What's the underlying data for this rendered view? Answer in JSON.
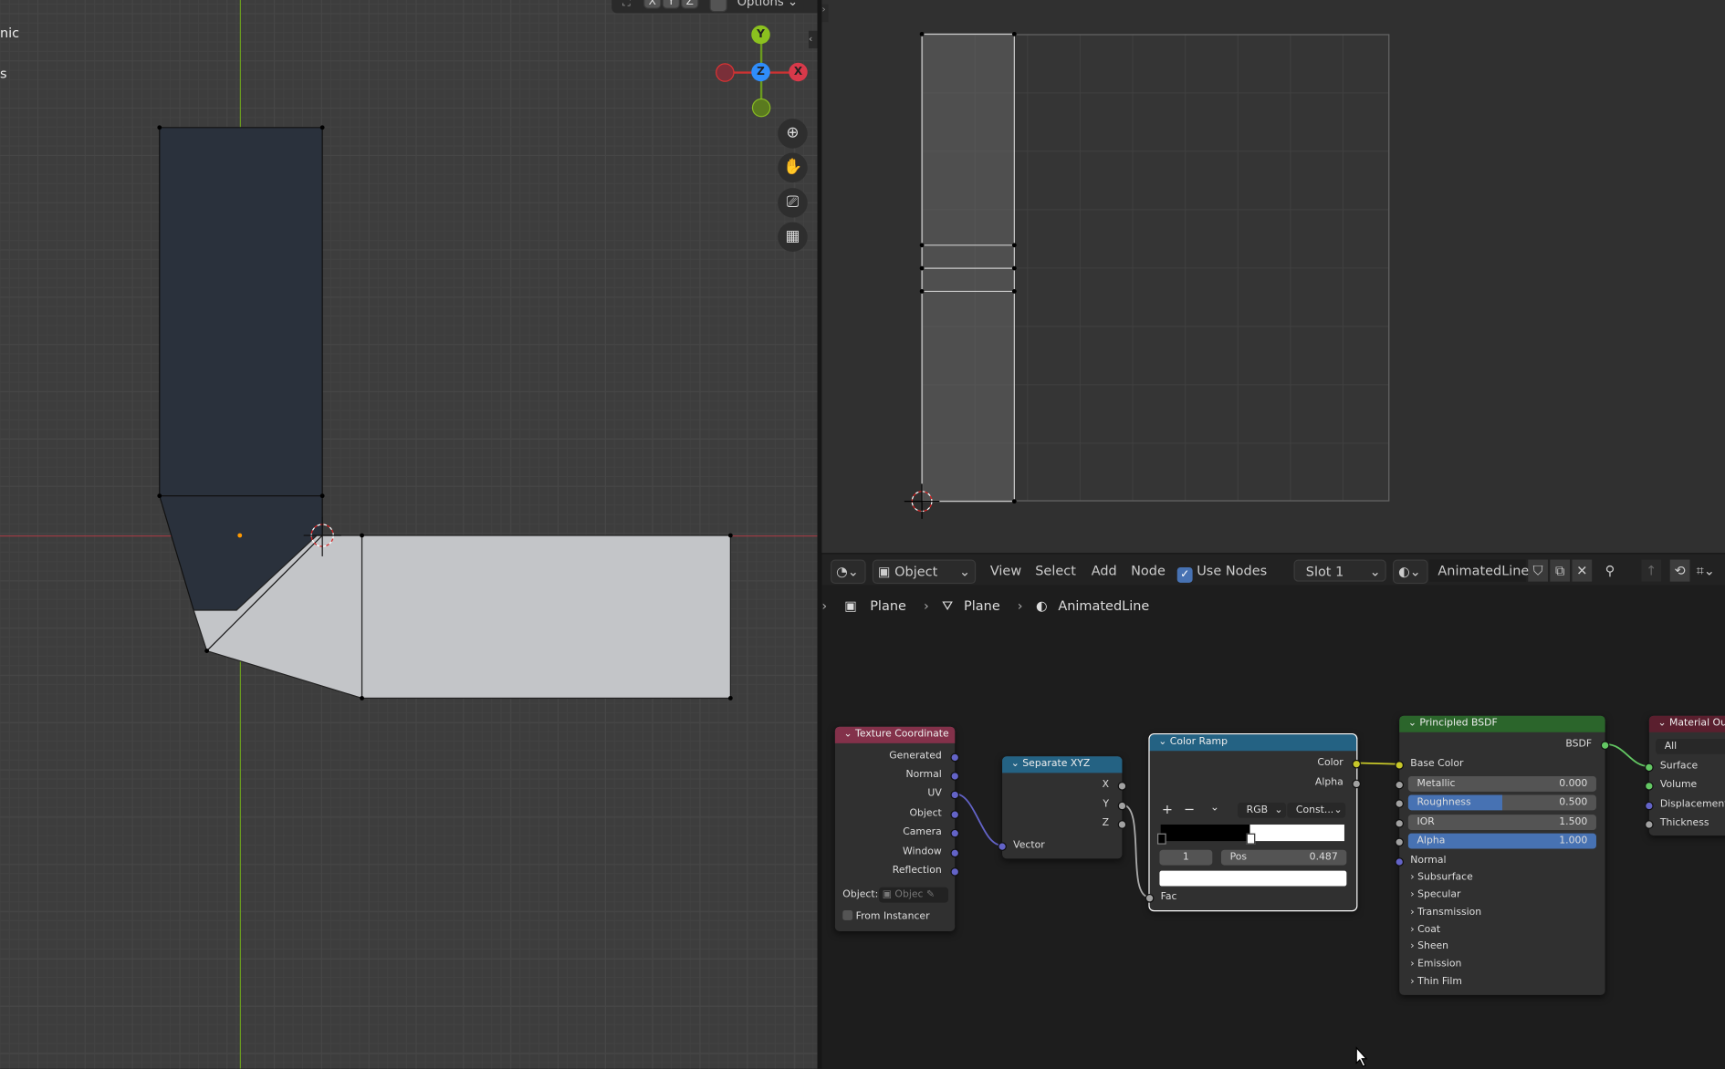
{
  "viewport": {
    "header_buttons": [
      "X",
      "Y",
      "Z"
    ],
    "options_label": "Options",
    "left_text": [
      "nic",
      "s"
    ],
    "gizmo": {
      "y": "Y",
      "x": "X",
      "z": "Z"
    },
    "nav_icons": [
      "zoom-icon",
      "hand-pan-icon",
      "camera-icon",
      "grid-icon"
    ],
    "colors": {
      "dark_mesh": "#2a313c",
      "light_mesh": "#c3c5c8",
      "x_axis": "#9c3c45",
      "y_axis": "#6a9a1f"
    }
  },
  "node_editor": {
    "header": {
      "editor_type_icon": "shader-editor-icon",
      "mode": "Object",
      "menus": [
        "View",
        "Select",
        "Add",
        "Node"
      ],
      "use_nodes_label": "Use Nodes",
      "use_nodes_checked": true,
      "slot": "Slot 1",
      "material": "AnimatedLine"
    },
    "breadcrumb": [
      "Plane",
      "Plane",
      "AnimatedLine"
    ],
    "nodes": {
      "texcoord": {
        "title": "Texture Coordinate",
        "outputs": [
          "Generated",
          "Normal",
          "UV",
          "Object",
          "Camera",
          "Window",
          "Reflection"
        ],
        "object_label": "Object:",
        "object_placeholder": "Objec",
        "from_instancer": "From Instancer",
        "color": "#83314a"
      },
      "sepxyz": {
        "title": "Separate XYZ",
        "outputs": [
          "X",
          "Y",
          "Z"
        ],
        "input": "Vector",
        "color": "#246283"
      },
      "colorramp": {
        "title": "Color Ramp",
        "outputs": [
          "Color",
          "Alpha"
        ],
        "color_mode": "RGB",
        "interpolation": "Const...",
        "index": "1",
        "pos_label": "Pos",
        "pos_value": "0.487",
        "input": "Fac",
        "color": "#246283"
      },
      "bsdf": {
        "title": "Principled BSDF",
        "output": "BSDF",
        "base_color": "Base Color",
        "fields": [
          {
            "label": "Metallic",
            "value": "0.000",
            "fill": 0
          },
          {
            "label": "Roughness",
            "value": "0.500",
            "fill": 0.5
          },
          {
            "label": "IOR",
            "value": "1.500",
            "fill": 0
          },
          {
            "label": "Alpha",
            "value": "1.000",
            "fill": 1
          }
        ],
        "normal": "Normal",
        "panels": [
          "Subsurface",
          "Specular",
          "Transmission",
          "Coat",
          "Sheen",
          "Emission",
          "Thin Film"
        ],
        "color": "#2b652b"
      },
      "output": {
        "title": "Material Out",
        "target": "All",
        "inputs": [
          "Surface",
          "Volume",
          "Displacement",
          "Thickness"
        ],
        "color": "#5a1f2e"
      }
    }
  }
}
